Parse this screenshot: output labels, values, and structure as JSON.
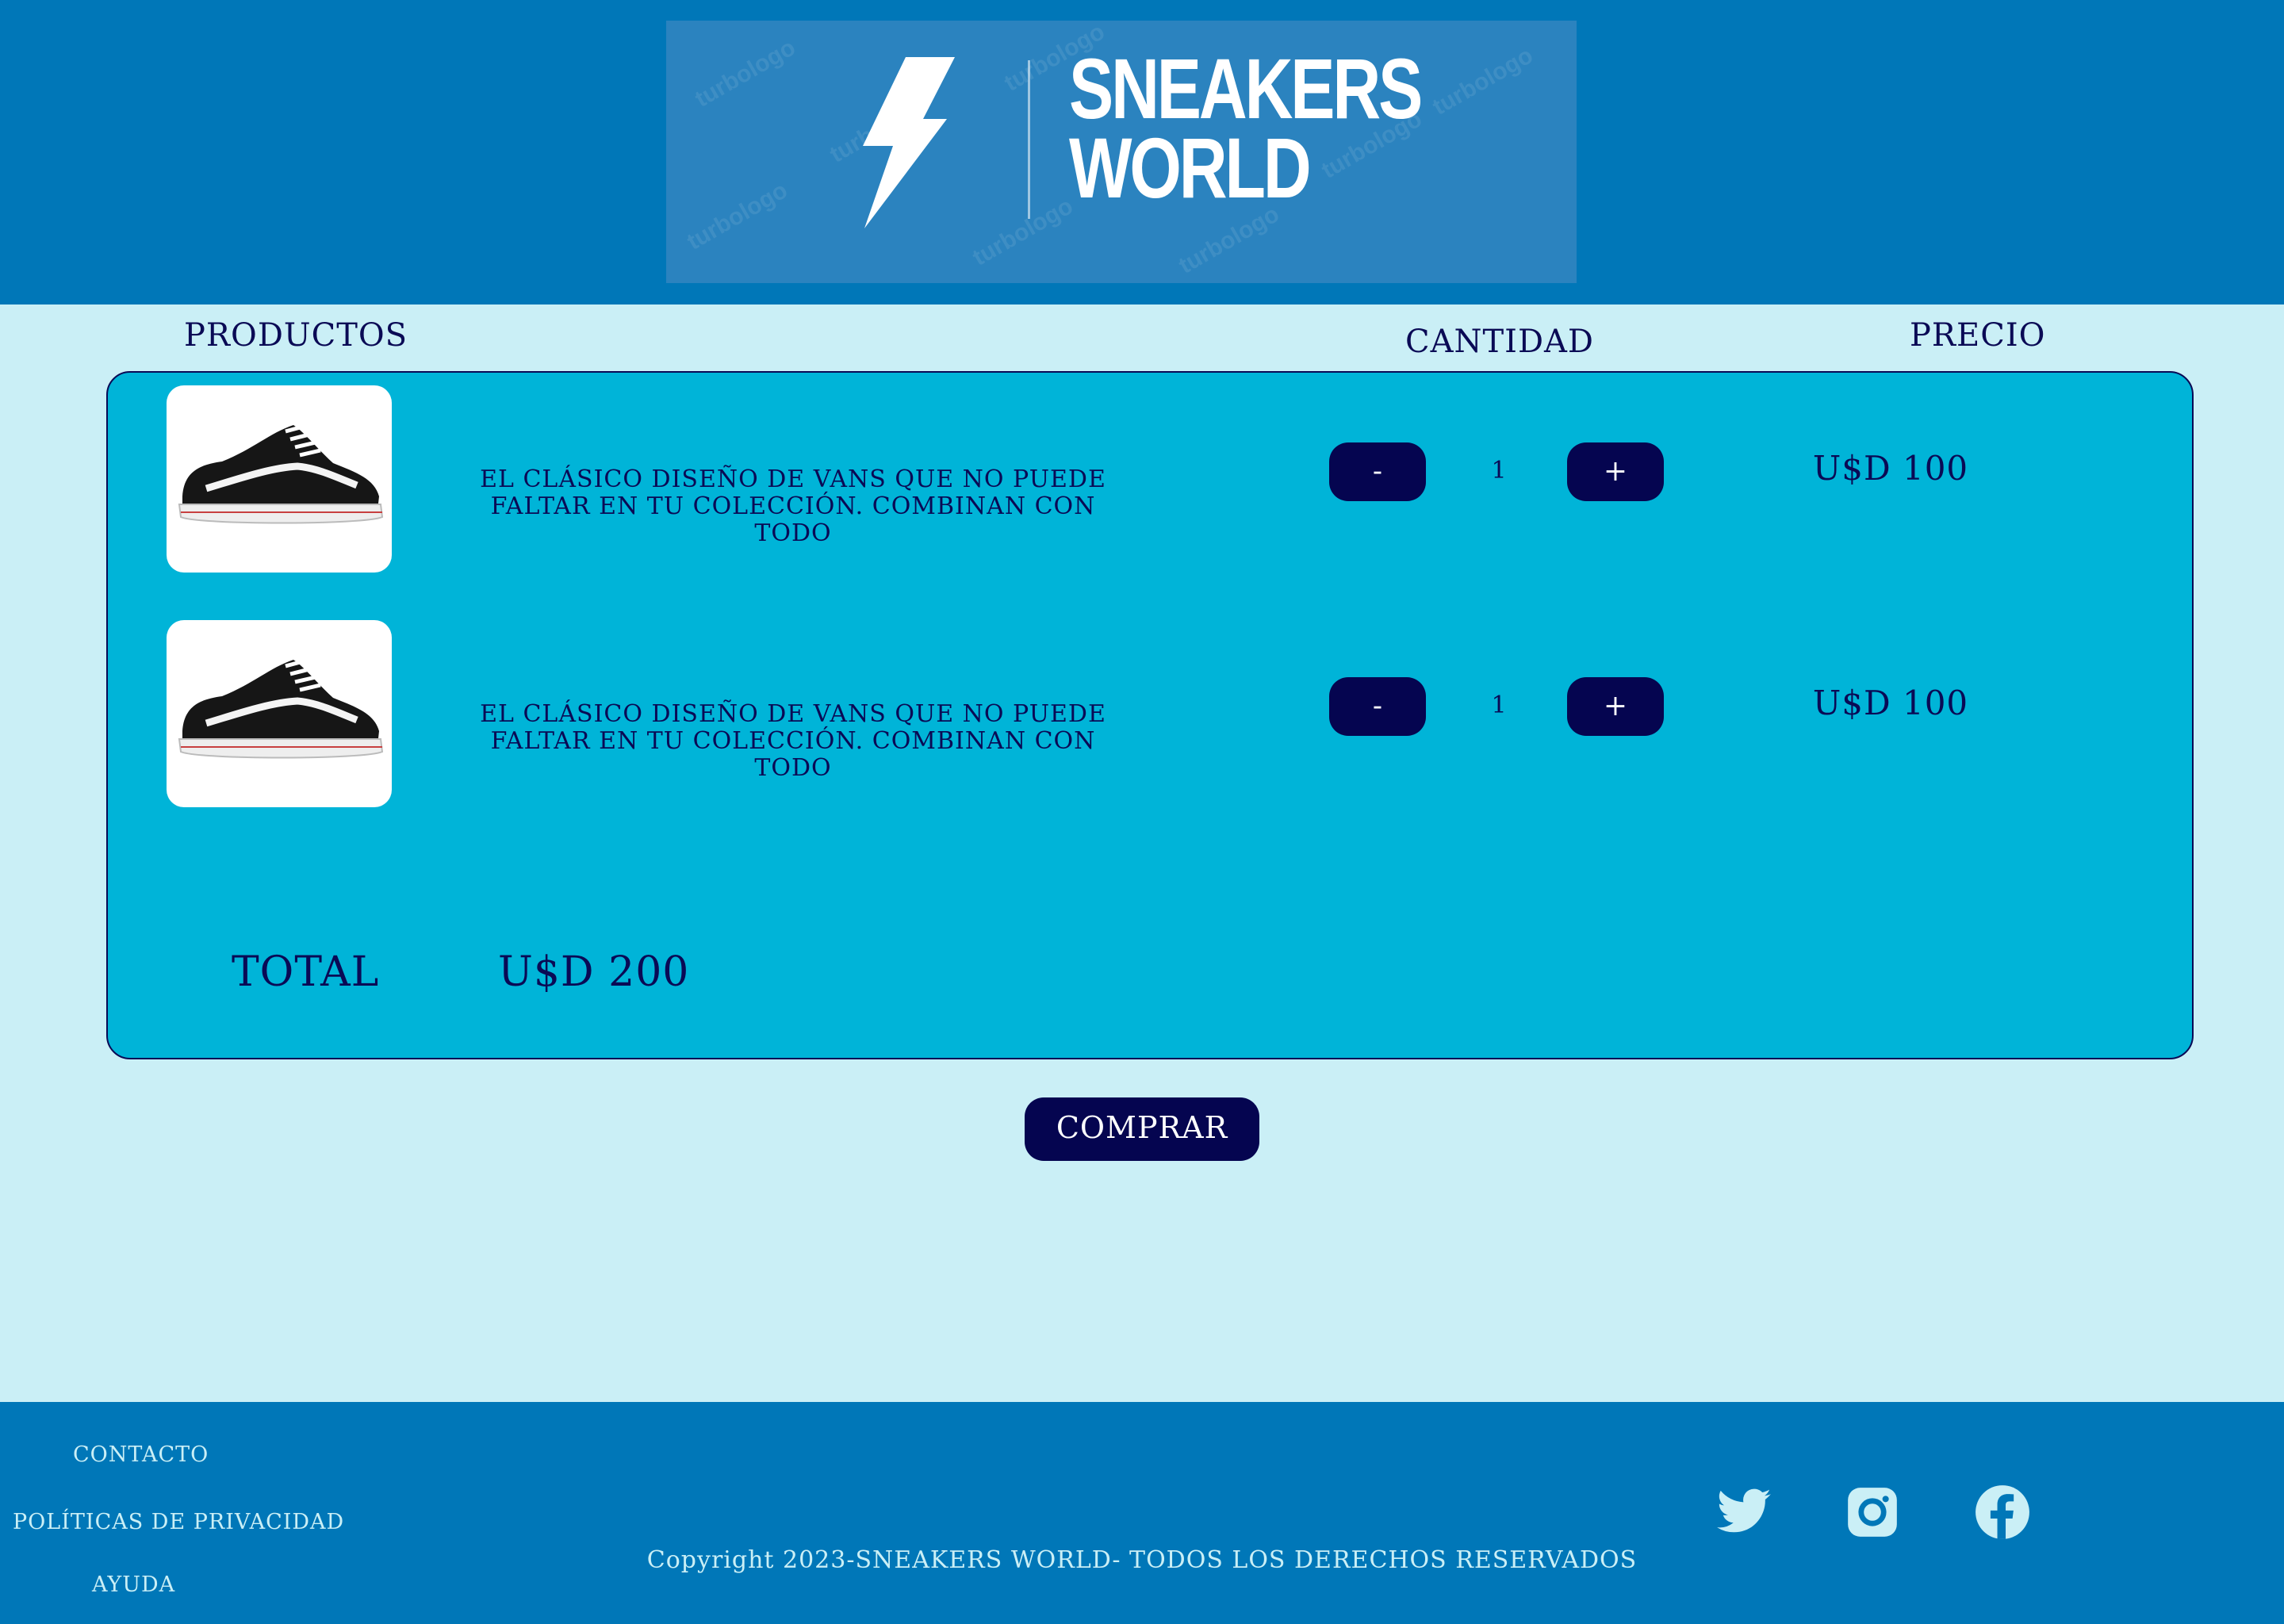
{
  "header": {
    "logo_line1": "SNEAKERS",
    "logo_line2": "WORLD",
    "logo_watermark": "turbologo"
  },
  "columns": {
    "products": "PRODUCTOS",
    "quantity": "CANTIDAD",
    "price": "PRECIO"
  },
  "cart": {
    "items": [
      {
        "description_line1": "EL CLÁSICO DISEÑO DE VANS QUE NO PUEDE",
        "description_line2": "FALTAR EN TU COLECCIÓN. COMBINAN CON TODO",
        "decrement": "-",
        "quantity": "1",
        "increment": "+",
        "price": "U$D 100"
      },
      {
        "description_line1": "EL CLÁSICO DISEÑO DE VANS QUE NO PUEDE",
        "description_line2": "FALTAR EN TU COLECCIÓN. COMBINAN CON TODO",
        "decrement": "-",
        "quantity": "1",
        "increment": "+",
        "price": "U$D 100"
      }
    ],
    "total_label": "TOTAL",
    "total_value": "U$D 200"
  },
  "buy_label": "COMPRAR",
  "footer": {
    "links": [
      "CONTACTO",
      "POLÍTICAS DE PRIVACIDAD",
      "AYUDA"
    ],
    "copyright": "Copyright 2023-SNEAKERS WORLD- TODOS LOS DERECHOS RESERVADOS",
    "social": [
      "twitter-icon",
      "instagram-icon",
      "facebook-icon"
    ]
  },
  "colors": {
    "header_bg": "#0077b8",
    "page_bg": "#caeff6",
    "cart_bg": "#00b4d8",
    "button_bg": "#050550",
    "text": "#0a0a55"
  }
}
